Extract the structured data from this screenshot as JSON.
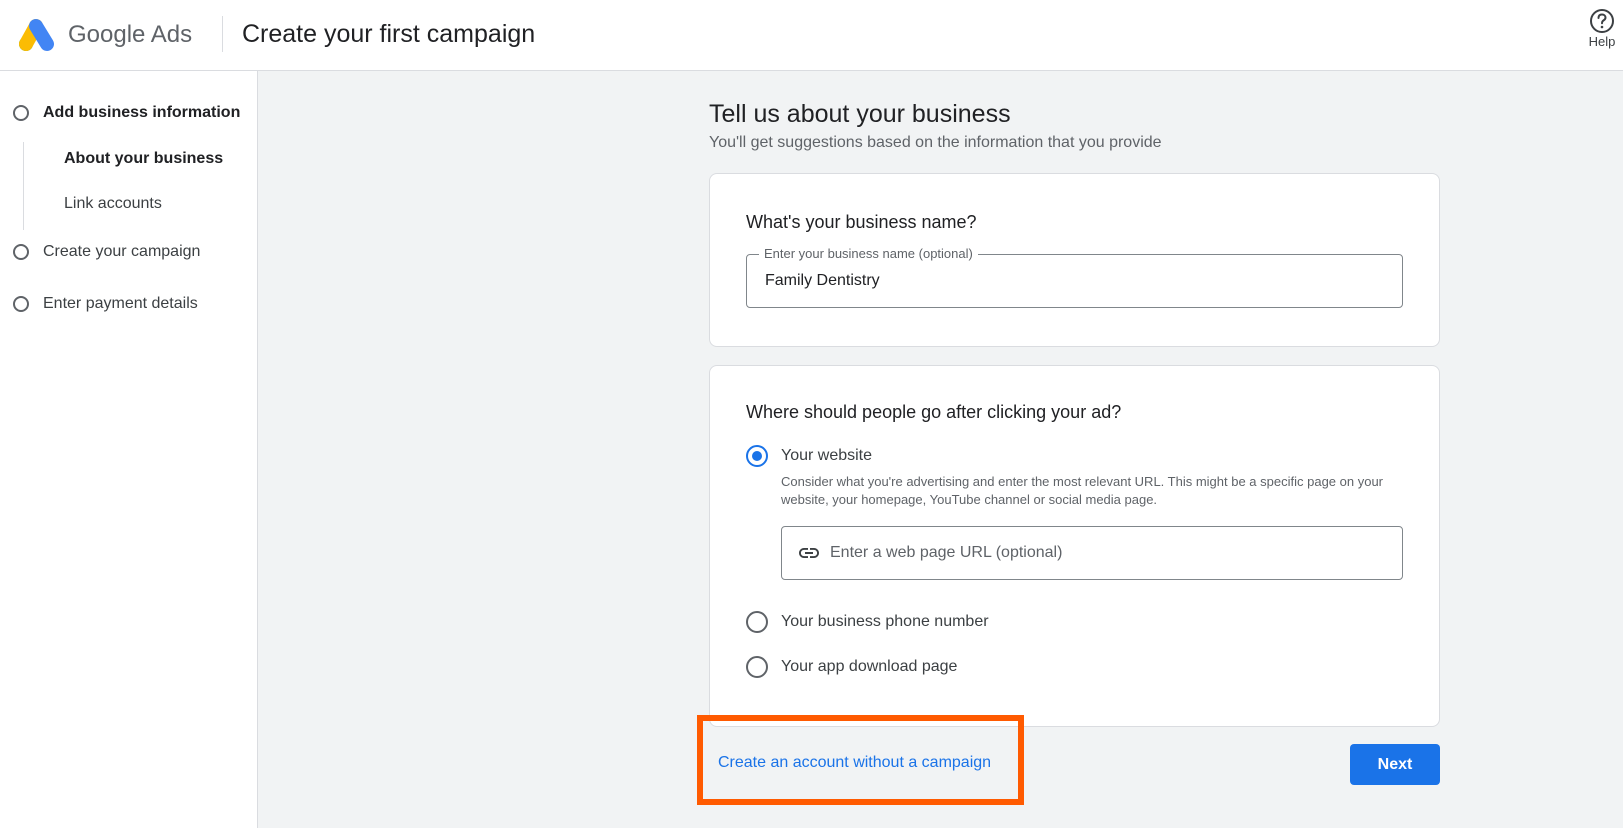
{
  "header": {
    "brand": "Google Ads",
    "title": "Create your first campaign",
    "help_label": "Help",
    "help_icon": "help-circle-icon",
    "logo_colors": [
      "#fbbc04",
      "#4285f4",
      "#34a853"
    ]
  },
  "sidebar": {
    "steps": [
      {
        "label": "Add business information",
        "state": "current"
      },
      {
        "label": "Create your campaign",
        "state": "pending"
      },
      {
        "label": "Enter payment details",
        "state": "pending"
      }
    ],
    "substeps": [
      {
        "label": "About your business",
        "active": true
      },
      {
        "label": "Link accounts",
        "active": false
      }
    ]
  },
  "main": {
    "title": "Tell us about your business",
    "subtitle": "You'll get suggestions based on the information that you provide",
    "business_card": {
      "question": "What's your business name?",
      "field_label": "Enter your business name (optional)",
      "field_value": "Family Dentistry"
    },
    "destination_card": {
      "question": "Where should people go after clicking your ad?",
      "options": [
        {
          "label": "Your website",
          "selected": true
        },
        {
          "label": "Your business phone number",
          "selected": false
        },
        {
          "label": "Your app download page",
          "selected": false
        }
      ],
      "website_help": "Consider what you're advertising and enter the most relevant URL. This might be a specific page on your website, your homepage, YouTube channel or social media page.",
      "url_placeholder": "Enter a web page URL (optional)",
      "url_icon": "link-icon"
    },
    "footer": {
      "skip_link": "Create an account without a campaign",
      "next_label": "Next"
    }
  },
  "colors": {
    "accent": "#1a73e8",
    "highlight": "#ff5a00",
    "main_bg": "#f1f3f4"
  }
}
